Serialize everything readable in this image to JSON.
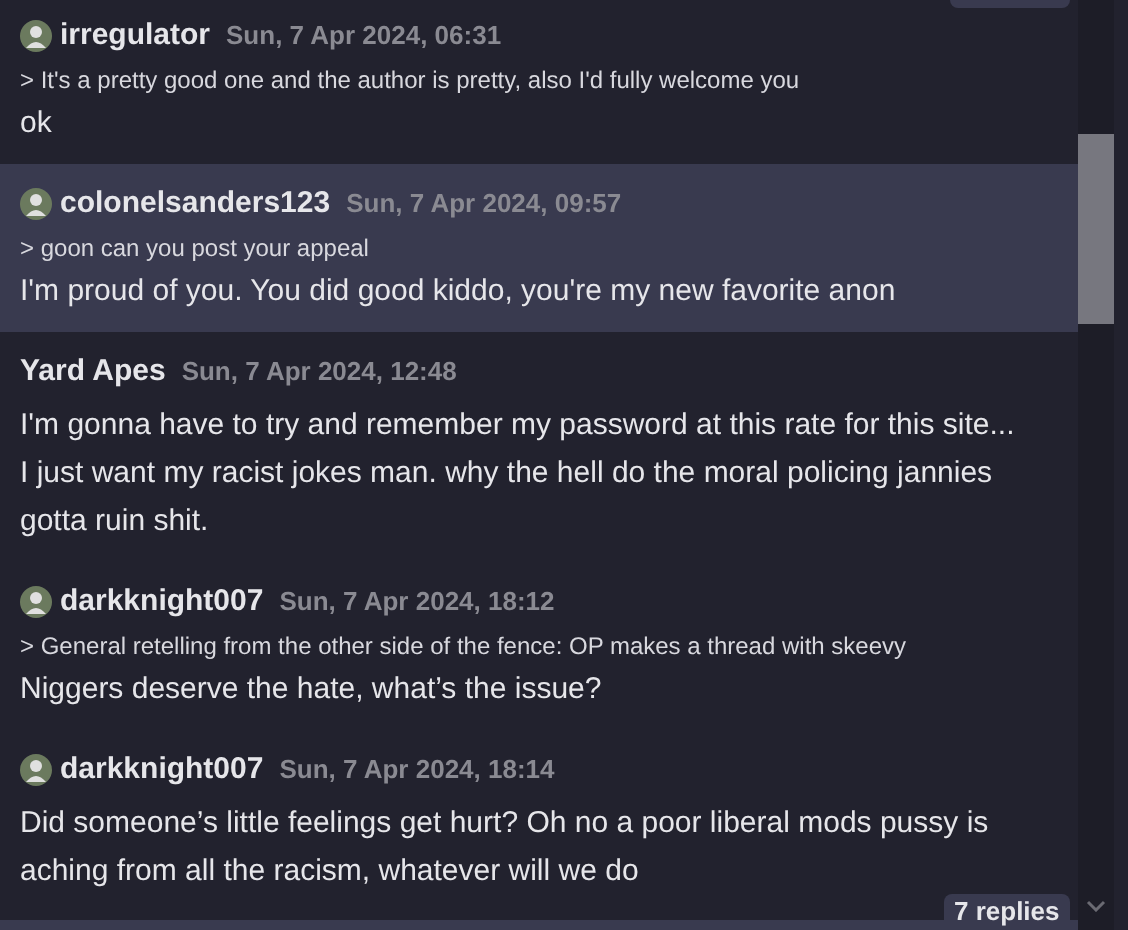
{
  "posts": [
    {
      "author": "irregulator",
      "avatar": true,
      "time": "Sun, 7 Apr 2024, 06:31",
      "quote": "> It's a pretty good one and the author is pretty, also I'd fully welcome you",
      "body": "ok",
      "selected": false
    },
    {
      "author": "colonelsanders123",
      "avatar": true,
      "time": "Sun, 7 Apr 2024, 09:57",
      "quote": "> goon can you post your appeal",
      "body": "I'm proud of you. You did good kiddo, you're my new favorite anon",
      "selected": true
    },
    {
      "author": "Yard Apes",
      "avatar": false,
      "time": "Sun, 7 Apr 2024, 12:48",
      "body": "I'm gonna have to try and remember my password at this rate for this site... I just want my racist jokes man. why the hell do the moral policing jannies gotta ruin shit.",
      "selected": false
    },
    {
      "author": "darkknight007",
      "avatar": true,
      "time": "Sun, 7 Apr 2024, 18:12",
      "quote": "> General retelling from the other side of the fence: OP makes a thread with skeevy",
      "body": "Niggers deserve the hate, what’s the issue?",
      "selected": false
    },
    {
      "author": "darkknight007",
      "avatar": true,
      "time": "Sun, 7 Apr 2024, 18:14",
      "body": "Did someone’s little feelings get hurt? Oh no a poor liberal mods pussy is aching from all the racism, whatever will we do",
      "selected": false
    }
  ],
  "replies_badge": "7 replies"
}
